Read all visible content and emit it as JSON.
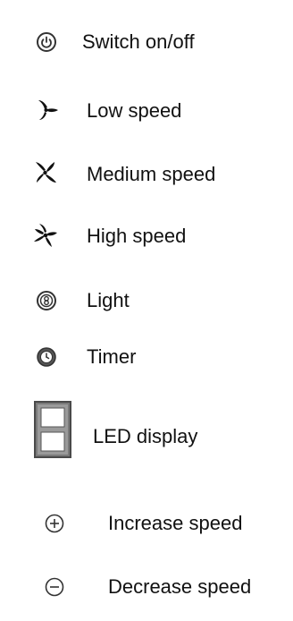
{
  "legend": {
    "items": [
      {
        "icon": "power-icon",
        "label": "Switch on/off"
      },
      {
        "icon": "fan-low-icon",
        "label": "Low speed"
      },
      {
        "icon": "fan-medium-icon",
        "label": "Medium speed"
      },
      {
        "icon": "fan-high-icon",
        "label": "High speed"
      },
      {
        "icon": "light-icon",
        "label": "Light"
      },
      {
        "icon": "timer-icon",
        "label": "Timer"
      },
      {
        "icon": "led-display-icon",
        "label": "LED display"
      },
      {
        "icon": "plus-icon",
        "label": "Increase speed"
      },
      {
        "icon": "minus-icon",
        "label": "Decrease speed"
      }
    ]
  }
}
